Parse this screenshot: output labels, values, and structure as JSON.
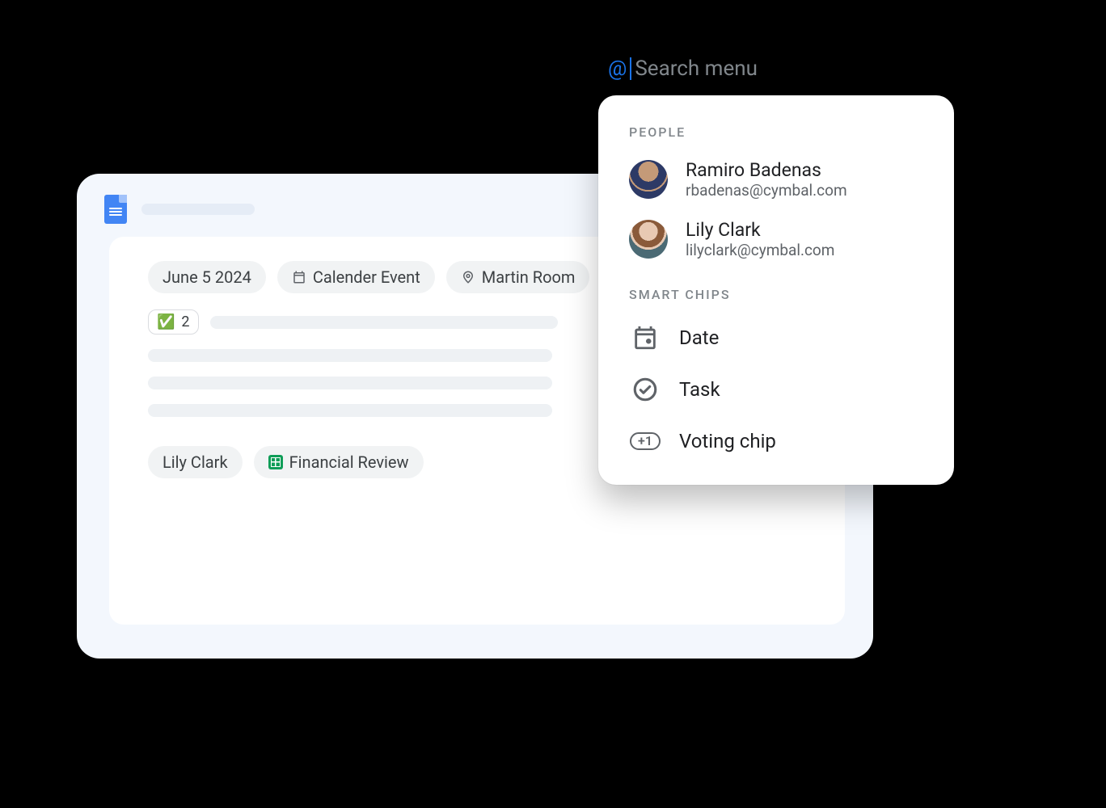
{
  "doc": {
    "chips": {
      "date": "June 5 2024",
      "event": "Calender Event",
      "location": "Martin Room"
    },
    "vote_count": "2",
    "mentions": {
      "person": "Lily Clark",
      "file": "Financial Review"
    }
  },
  "search": {
    "at_symbol": "@",
    "placeholder": "Search menu",
    "sections": {
      "people_label": "PEOPLE",
      "chips_label": "SMART CHIPS"
    },
    "people": [
      {
        "name": "Ramiro Badenas",
        "email": "rbadenas@cymbal.com"
      },
      {
        "name": "Lily Clark",
        "email": "lilyclark@cymbal.com"
      }
    ],
    "chips": [
      {
        "label": "Date"
      },
      {
        "label": "Task"
      },
      {
        "label": "Voting chip"
      }
    ],
    "plus1": "+1"
  }
}
